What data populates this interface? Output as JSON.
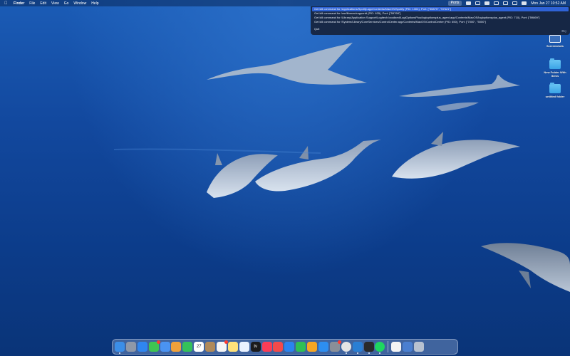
{
  "menubar": {
    "app_name": "Finder",
    "menus": [
      "File",
      "Edit",
      "View",
      "Go",
      "Window",
      "Help"
    ],
    "ports_label": "Ports",
    "datetime": "Mon Jan 27  10:52 AM"
  },
  "dropdown": {
    "items": [
      "Get kill command for /Applications/Spotify.app/Contents/MacOS/Spotify (PID: 1304), Port: [\"55875\", \"57621\"]",
      "Get kill command for /usr/libexec/rapportd (PID: 635), Port: [\"55768\"]",
      "Get kill command for /Library/Application Support/Logitech.localized/LogiOptionsPlus/logioptionsplus_agent.app/Contents/MacOS/logioptionsplus_agent (PID: 710), Port: [\"59869\"]",
      "Get kill command for /System/Library/CoreServices/ControlCenter.app/Contents/MacOS/ControlCenter (PID: 650), Port: [\"7000\", \"5000\"]"
    ],
    "quit_label": "Quit",
    "quit_shortcut": "⌘Q"
  },
  "desktop_icons": [
    {
      "label": "Screenshots",
      "icon": "monitor-icon"
    },
    {
      "label": "New Folder With Items",
      "icon": "folder-icon"
    },
    {
      "label": "untitled folder",
      "icon": "folder-icon"
    }
  ],
  "dock": {
    "apps": [
      {
        "name": "finder",
        "color": "#3b8ee8",
        "running": true
      },
      {
        "name": "launchpad",
        "color": "#8f98a8"
      },
      {
        "name": "safari",
        "color": "#2f86f0"
      },
      {
        "name": "messages",
        "color": "#3fc452",
        "badge": true
      },
      {
        "name": "mail",
        "color": "#4a93f2"
      },
      {
        "name": "photos",
        "color": "#f0a13b"
      },
      {
        "name": "facetime",
        "color": "#34c15a"
      },
      {
        "name": "calendar",
        "color": "#ffffff",
        "text": "27"
      },
      {
        "name": "contacts",
        "color": "#b08a5a"
      },
      {
        "name": "reminders",
        "color": "#f5f5f5",
        "badge": true
      },
      {
        "name": "notes",
        "color": "#ffe27a"
      },
      {
        "name": "freeform",
        "color": "#e9f2ff"
      },
      {
        "name": "tv",
        "color": "#1b1b1b",
        "text": "tv"
      },
      {
        "name": "music",
        "color": "#fa3d56"
      },
      {
        "name": "news",
        "color": "#f34a4a"
      },
      {
        "name": "keynote",
        "color": "#2a84f0"
      },
      {
        "name": "numbers",
        "color": "#2fbf55"
      },
      {
        "name": "pages",
        "color": "#f6a623"
      },
      {
        "name": "app-store",
        "color": "#2d8ef0"
      },
      {
        "name": "system-settings",
        "color": "#8a8f98",
        "badge": true
      },
      {
        "name": "chrome",
        "color": "#e4e4e4",
        "running": true,
        "round": true
      },
      {
        "name": "vscode",
        "color": "#2a7fd4",
        "running": true
      },
      {
        "name": "terminal",
        "color": "#2a2a2a",
        "running": true
      },
      {
        "name": "spotify",
        "color": "#1ed760",
        "running": true,
        "round": true
      }
    ],
    "trailing": [
      {
        "name": "document",
        "color": "#f4f4f4"
      },
      {
        "name": "downloads",
        "color": "#4a7fd0"
      },
      {
        "name": "trash",
        "color": "#b8c2d0"
      }
    ]
  }
}
